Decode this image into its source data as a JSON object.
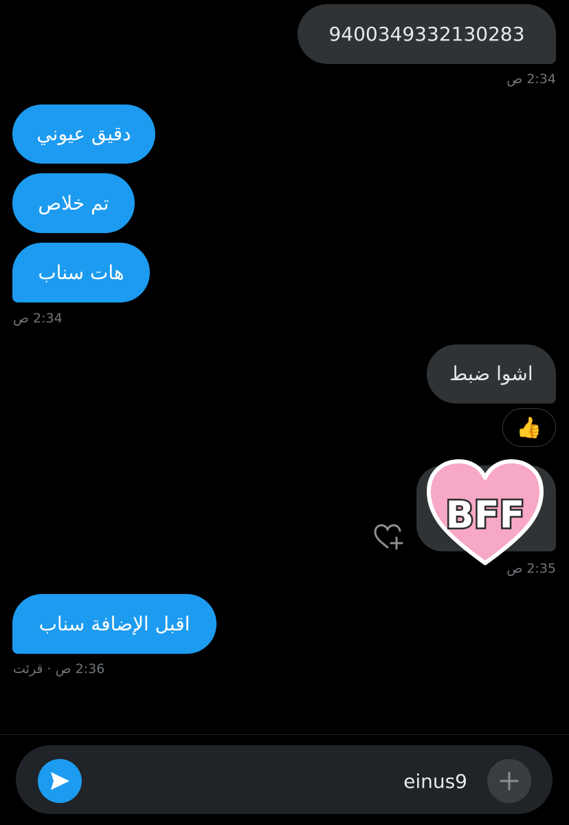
{
  "messages": [
    {
      "text": "9400349332130283"
    },
    {
      "text": "دقيق عيوني"
    },
    {
      "text": "تم خلاص"
    },
    {
      "text": "هات سناب"
    },
    {
      "text": "اشوا ضبط"
    },
    {
      "text": "اقبل الإضافة سناب"
    }
  ],
  "timestamps": {
    "t1": "2:34 ص",
    "t2": "2:34 ص",
    "t3": "2:35 ص",
    "t4": "2:36 ص · قرئت"
  },
  "reaction": {
    "emoji": "👍"
  },
  "sticker": {
    "text": "BFF",
    "color": "#f7a8c6"
  },
  "composer": {
    "value": "einus9"
  },
  "icons": {
    "send": "send-icon",
    "add": "plus-icon",
    "react": "heart-add-icon"
  },
  "colors": {
    "background": "#000000",
    "outgoing_bubble": "#2f3336",
    "incoming_bubble": "#1d9bf0",
    "accent": "#1d9bf0"
  }
}
